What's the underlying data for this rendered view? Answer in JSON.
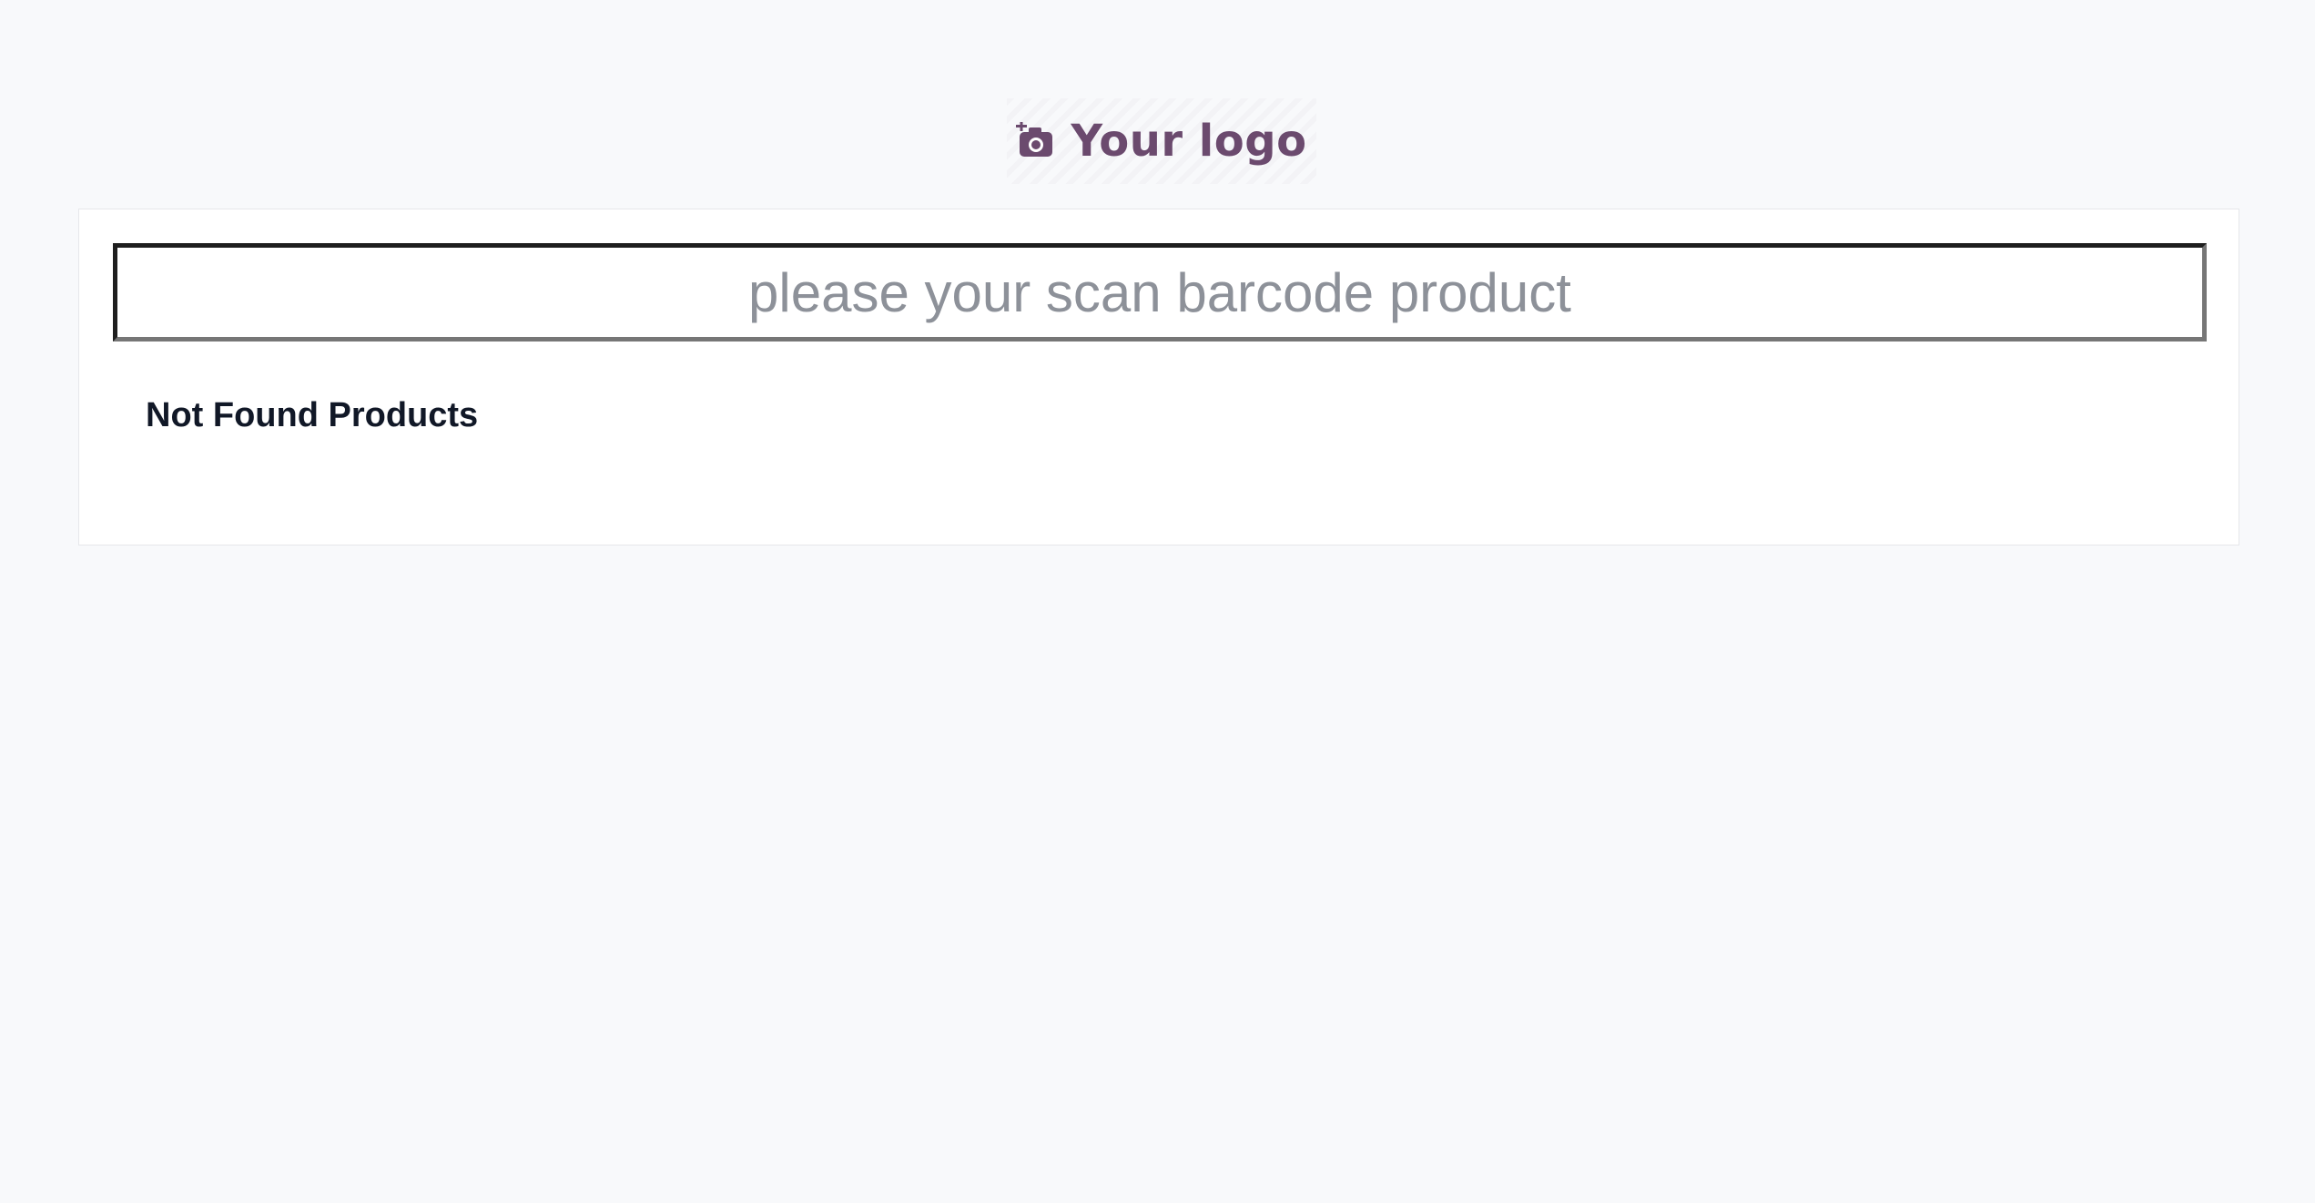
{
  "logo": {
    "text": "Your logo",
    "icon": "camera-plus-icon",
    "color": "#6b4a6e"
  },
  "scan": {
    "placeholder": "please your scan barcode product",
    "value": ""
  },
  "results": {
    "message": "Not Found Products"
  },
  "colors": {
    "background": "#f8f9fb",
    "card": "#ffffff",
    "placeholder": "#8d9199",
    "heading": "#111827"
  }
}
